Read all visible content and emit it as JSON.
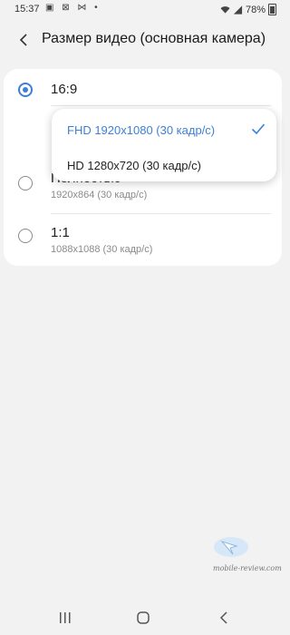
{
  "status_bar": {
    "time": "15:37",
    "notifications": "▣ ⊠ ⋈ •",
    "battery": "78%"
  },
  "header": {
    "title": "Размер видео (основная камера)"
  },
  "options": [
    {
      "label": "16:9",
      "sub": "",
      "selected": true
    },
    {
      "label": "Полностью",
      "sub": "1920x864 (30 кадр/с)",
      "selected": false
    },
    {
      "label": "1:1",
      "sub": "1088x1088 (30 кадр/с)",
      "selected": false
    }
  ],
  "dropdown": {
    "items": [
      {
        "label": "FHD 1920x1080 (30 кадр/с)",
        "active": true
      },
      {
        "label": "HD 1280x720 (30 кадр/с)",
        "active": false
      }
    ]
  },
  "watermark": {
    "text": "mobile-review.com"
  },
  "colors": {
    "accent": "#3d7fd6",
    "background": "#f2f2f2",
    "card": "#ffffff"
  }
}
